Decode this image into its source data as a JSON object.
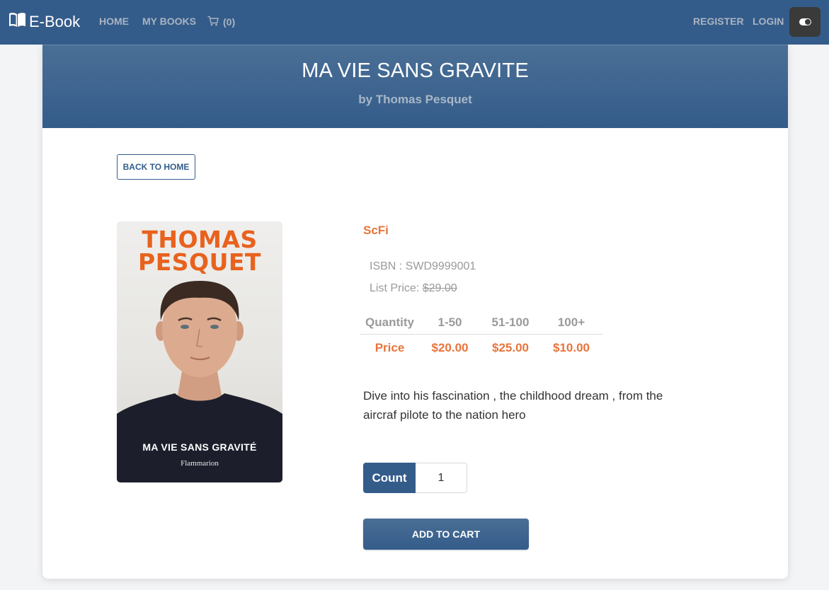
{
  "nav": {
    "brand": "E-Book",
    "home": "HOME",
    "my_books": "MY BOOKS",
    "cart": "(0)",
    "register": "REGISTER",
    "login": "LOGIN"
  },
  "book": {
    "title": "MA VIE SANS GRAVITE",
    "author": "by Thomas Pesquet",
    "category": "ScFi",
    "isbn_label": "ISBN : SWD9999001",
    "list_price_label": "List Price: ",
    "list_price": "$29.00",
    "description": "Dive into his fascination , the childhood dream , from the aircraf pilote to the nation hero",
    "cover": {
      "author_line1": "THOMAS",
      "author_line2": "PESQUET",
      "title": "MA VIE SANS GRAVITÉ",
      "publisher": "Flammarion"
    }
  },
  "back_button": "BACK TO HOME",
  "price_table": {
    "head": [
      "Quantity",
      "1-50",
      "51-100",
      "100+"
    ],
    "row": [
      "Price",
      "$20.00",
      "$25.00",
      "$10.00"
    ]
  },
  "count": {
    "label": "Count",
    "value": "1"
  },
  "add_to_cart": "ADD TO CART",
  "colors": {
    "primary": "#345c8a",
    "accent": "#e8743b"
  }
}
